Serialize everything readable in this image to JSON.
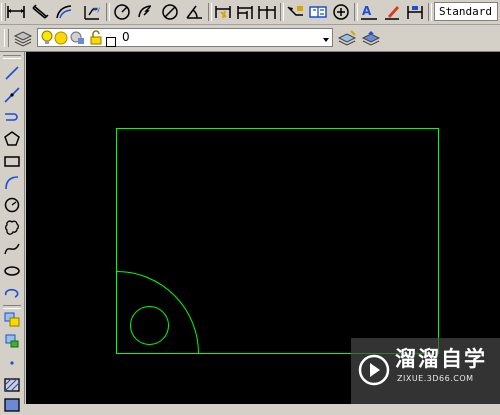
{
  "toolbar_top": {
    "text_style": "Standard",
    "icons": [
      "dim-linear-icon",
      "dim-aligned-icon",
      "dim-arc-icon",
      "dim-ordinate-icon",
      "dim-radius-icon",
      "dim-jogged-icon",
      "dim-diameter-icon",
      "dim-angular-icon",
      "quick-dim-icon",
      "dim-baseline-icon",
      "dim-continue-icon",
      "quick-leader-icon",
      "tolerance-icon",
      "center-mark-icon",
      "dim-edit-icon",
      "dim-text-edit-icon",
      "dim-update-icon"
    ]
  },
  "toolbar_layers": {
    "current_layer": "0",
    "icons": [
      "layer-manager-icon",
      "layer-on-icon",
      "layer-freeze-icon",
      "layer-vp-freeze-icon",
      "layer-lock-icon",
      "layer-color-icon",
      "make-object-layer-current-icon",
      "layer-previous-icon"
    ]
  },
  "toolbar_draw": {
    "icons": [
      "line-icon",
      "construction-line-icon",
      "polyline-icon",
      "polygon-icon",
      "rectangle-icon",
      "arc-icon",
      "circle-icon",
      "revision-cloud-icon",
      "spline-icon",
      "ellipse-icon",
      "ellipse-arc-icon",
      "insert-block-icon",
      "make-block-icon",
      "point-icon",
      "hatch-icon",
      "gradient-icon"
    ]
  },
  "drawing": {
    "line_color": "#00ff00",
    "background": "#000000",
    "entities": [
      "rectangle",
      "quarter-arc",
      "circle"
    ]
  },
  "watermark": {
    "title": "溜溜自学",
    "url": "ZIXUE.3D66.COM"
  }
}
